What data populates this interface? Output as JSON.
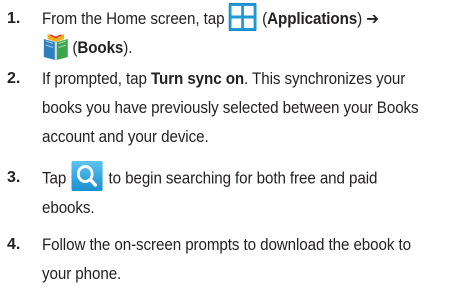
{
  "steps": [
    {
      "number": "1.",
      "line1_pre": "From the Home screen, tap",
      "line1_open": "(",
      "line1_bold": "Applications",
      "line1_close": ") ➔",
      "line2_open": "(",
      "line2_bold": "Books",
      "line2_close": ")."
    },
    {
      "number": "2.",
      "line1_pre": "If prompted, tap ",
      "line1_bold": "Turn sync on",
      "line1_post": ". This synchronizes your",
      "line2": "books you have previously selected between your Books",
      "line3": "account and your device."
    },
    {
      "number": "3.",
      "line1_pre": "Tap",
      "line1_post": "to begin searching for both free and paid",
      "line2": "ebooks."
    },
    {
      "number": "4.",
      "line1": "Follow the on-screen prompts to download the ebook to",
      "line2": "your phone."
    }
  ],
  "icons": {
    "applications": "applications-grid-icon",
    "books": "books-icon",
    "search": "search-icon"
  },
  "colors": {
    "text": "#231f20",
    "apps_blue": "#1f9ad6",
    "search_blue": "#1ea1e0"
  }
}
